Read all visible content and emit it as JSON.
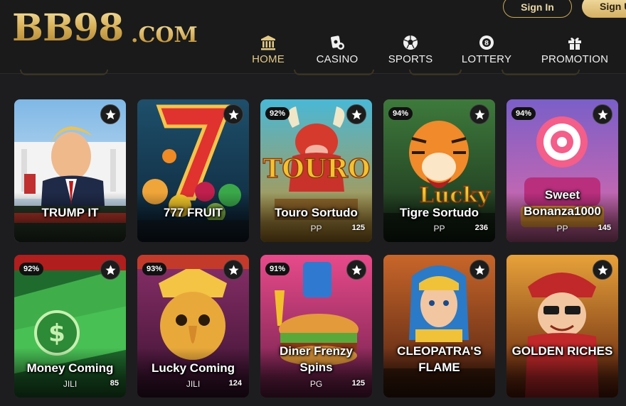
{
  "brand": {
    "logo": "BB98",
    "tld": ".COM"
  },
  "auth": {
    "signin_label": "Sign In",
    "signup_label": "Sign U"
  },
  "nav": {
    "items": [
      {
        "label": "HOME",
        "icon": "bank-icon"
      },
      {
        "label": "CASINO",
        "icon": "cards-icon"
      },
      {
        "label": "SPORTS",
        "icon": "soccer-ball-icon"
      },
      {
        "label": "LOTTERY",
        "icon": "lottery-ball-icon"
      },
      {
        "label": "PROMOTION",
        "icon": "gift-icon"
      }
    ],
    "active": "HOME"
  },
  "games": [
    {
      "title": "TRUMP IT",
      "provider": "",
      "players": "",
      "rtp": ""
    },
    {
      "title": "777 FRUIT",
      "provider": "",
      "players": "",
      "rtp": ""
    },
    {
      "title": "Touro Sortudo",
      "provider": "PP",
      "players": "125",
      "rtp": "92%"
    },
    {
      "title": "Tigre Sortudo",
      "provider": "PP",
      "players": "236",
      "rtp": "94%"
    },
    {
      "title": "Sweet Bonanza1000",
      "provider": "PP",
      "players": "145",
      "rtp": "94%"
    },
    {
      "title": "Money Coming",
      "provider": "JILI",
      "players": "85",
      "rtp": "92%"
    },
    {
      "title": "Lucky Coming",
      "provider": "JILI",
      "players": "124",
      "rtp": "93%"
    },
    {
      "title": "Diner Frenzy Spins",
      "provider": "PG",
      "players": "125",
      "rtp": "91%"
    },
    {
      "title": "CLEOPATRA'S FLAME",
      "provider": "",
      "players": "",
      "rtp": ""
    },
    {
      "title": "GOLDEN RICHES",
      "provider": "",
      "players": "",
      "rtp": ""
    }
  ],
  "colors": {
    "accent_gold": "#d9b25a",
    "background": "#1d1d1f"
  }
}
